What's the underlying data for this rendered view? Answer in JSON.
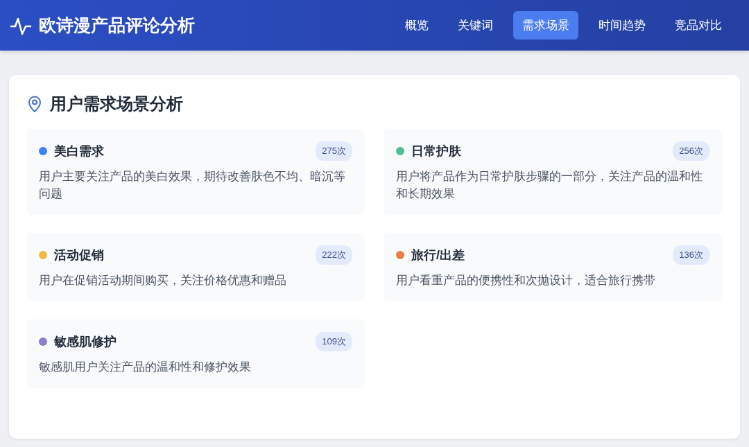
{
  "header": {
    "title": "欧诗漫产品评论分析"
  },
  "nav": [
    {
      "label": "概览",
      "selected": false
    },
    {
      "label": "关键词",
      "selected": false
    },
    {
      "label": "需求场景",
      "selected": true
    },
    {
      "label": "时间趋势",
      "selected": false
    },
    {
      "label": "竞品对比",
      "selected": false
    }
  ],
  "section": {
    "title": "用户需求场景分析",
    "scenarios": [
      {
        "name": "美白需求",
        "count": "275次",
        "color": "#3b82f6",
        "description": "用户主要关注产品的美白效果，期待改善肤色不均、暗沉等问题"
      },
      {
        "name": "日常护肤",
        "count": "256次",
        "color": "#4fbf94",
        "description": "用户将产品作为日常护肤步骤的一部分，关注产品的温和性和长期效果"
      },
      {
        "name": "活动促销",
        "count": "222次",
        "color": "#f5b942",
        "description": "用户在促销活动期间购买，关注价格优惠和赠品"
      },
      {
        "name": "旅行/出差",
        "count": "136次",
        "color": "#ee7d45",
        "description": "用户看重产品的便携性和次抛设计，适合旅行携带"
      },
      {
        "name": "敏感肌修护",
        "count": "109次",
        "color": "#8b7fd0",
        "description": "敏感肌用户关注产品的温和性和修护效果"
      }
    ]
  }
}
